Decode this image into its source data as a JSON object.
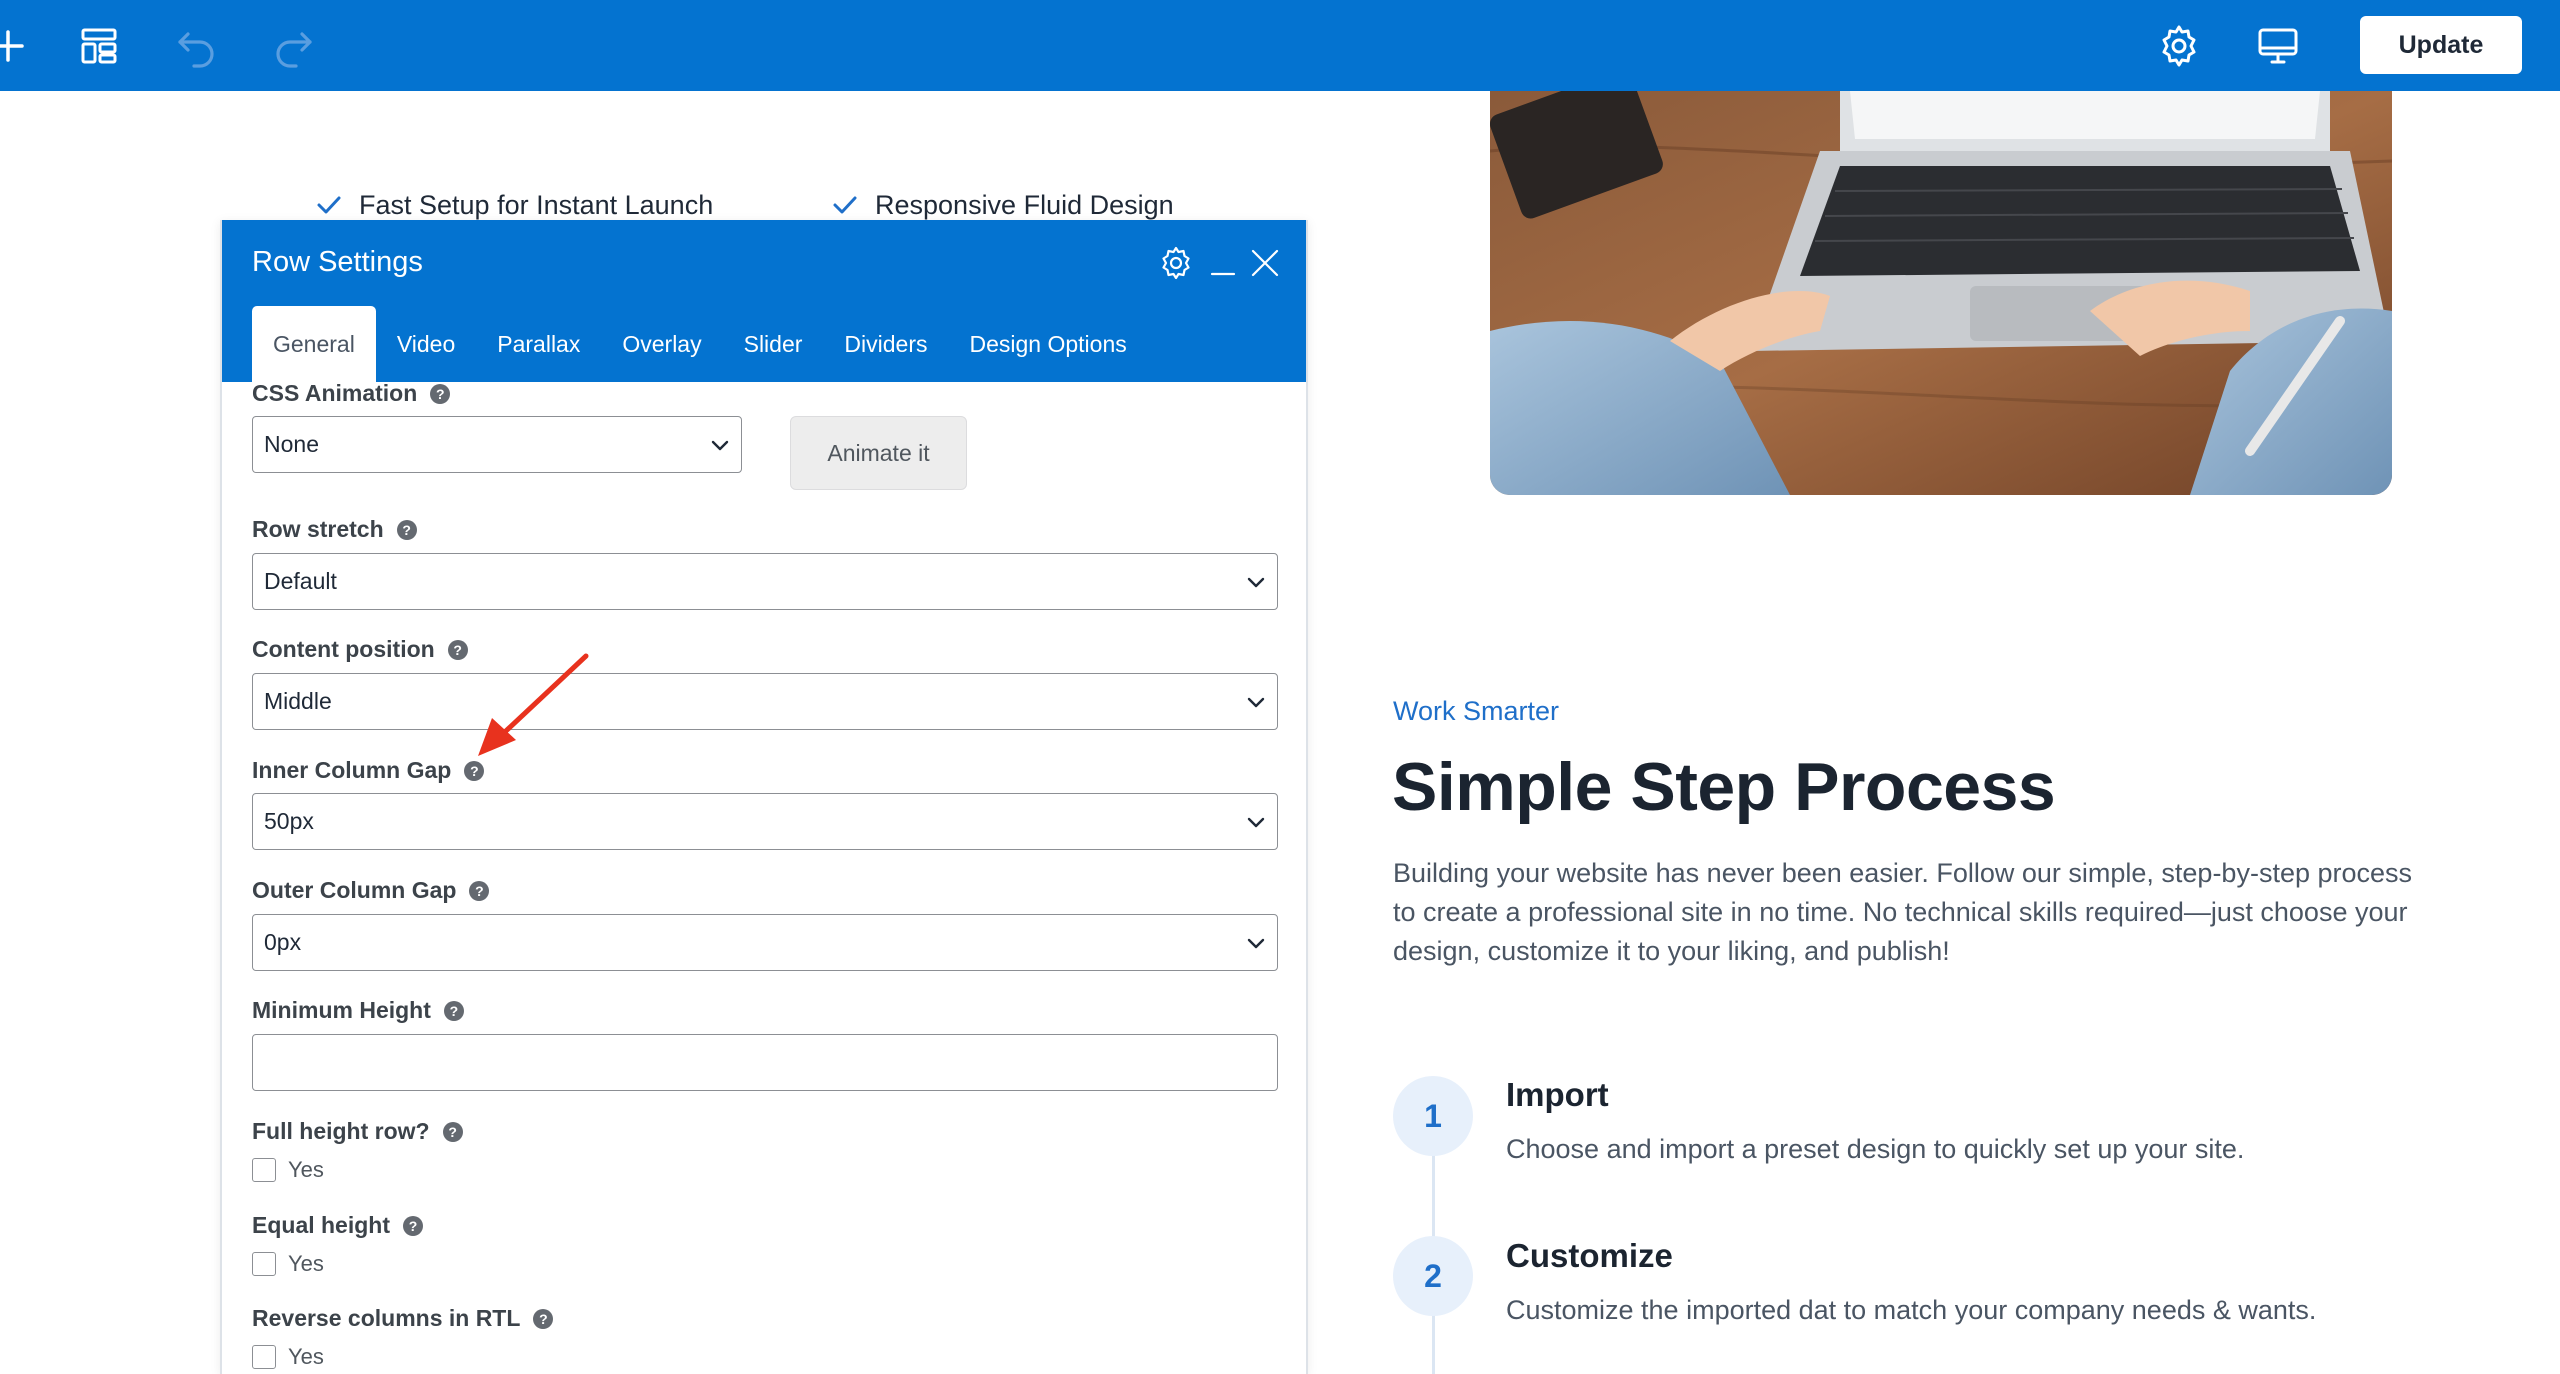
{
  "toolbar": {
    "icons": [
      "plus-icon",
      "layout-icon",
      "undo-icon",
      "redo-icon",
      "settings-gear-icon",
      "desktop-preview-icon"
    ],
    "update_label": "Update",
    "colors": {
      "bar": "#0473d0",
      "icon": "#ffffff",
      "icon_disabled": "#5a9ee0"
    }
  },
  "page": {
    "features": [
      "Fast Setup for Instant Launch",
      "Responsive Fluid Design"
    ],
    "eyebrow": "Work Smarter",
    "heading": "Simple Step Process",
    "lead": "Building your website has never been easier. Follow our simple, step-by-step process to create a professional site in no time. No technical skills required—just choose your design, customize it to your liking, and publish!",
    "steps": [
      {
        "number": "1",
        "title": "Import",
        "description": "Choose and import a preset design to quickly set up your site."
      },
      {
        "number": "2",
        "title": "Customize",
        "description": "Customize the imported dat to match your company needs & wants."
      }
    ],
    "colors": {
      "accent": "#1f6fc9",
      "heading": "#1b2430",
      "body": "#4a5563"
    }
  },
  "row_settings": {
    "title": "Row Settings",
    "tabs": [
      "General",
      "Video",
      "Parallax",
      "Overlay",
      "Slider",
      "Dividers",
      "Design Options"
    ],
    "active_tab": "General",
    "fields": {
      "css_animation": {
        "label": "CSS Animation",
        "value": "None",
        "button": "Animate it"
      },
      "row_stretch": {
        "label": "Row stretch",
        "value": "Default"
      },
      "content_position": {
        "label": "Content position",
        "value": "Middle"
      },
      "inner_column_gap": {
        "label": "Inner Column Gap",
        "value": "50px"
      },
      "outer_column_gap": {
        "label": "Outer Column Gap",
        "value": "0px"
      },
      "minimum_height": {
        "label": "Minimum Height",
        "value": ""
      },
      "full_height_row": {
        "label": "Full height row?",
        "option": "Yes",
        "checked": false
      },
      "equal_height": {
        "label": "Equal height",
        "option": "Yes",
        "checked": false
      },
      "reverse_columns_rtl": {
        "label": "Reverse columns in RTL",
        "option": "Yes",
        "checked": false
      }
    },
    "help_glyph": "?",
    "annotation_arrow_color": "#e8321e"
  }
}
